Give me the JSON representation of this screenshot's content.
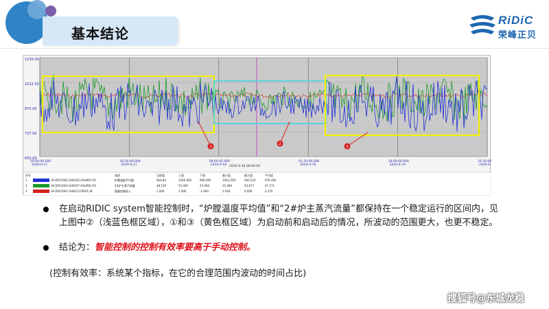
{
  "header": {
    "title": "基本结论"
  },
  "logo": {
    "name": "RiDiC",
    "subtitle": "荣峰正贝"
  },
  "chart": {
    "y_ticks": [
      "1150.00",
      "1012.50",
      "875.00",
      "737.50",
      "600.00"
    ],
    "x_ticks": [
      {
        "time": "00:00:00.000",
        "date": "2020-9-17"
      },
      {
        "time": "16:30:00.000",
        "date": "2020-9-17"
      },
      {
        "time": "09:00:00.000",
        "date": "2020-9-18"
      },
      {
        "time": "01:30:00.000",
        "date": "2020-9-19"
      },
      {
        "time": "18:00:00.000",
        "date": "2020-9-19"
      },
      {
        "time": "10:30:00.000",
        "date": "2020-9-20"
      }
    ],
    "range_label": "2020-9-18 08:00:00",
    "markers": [
      "1",
      "2",
      "3"
    ],
    "table": {
      "headers": [
        "序号",
        "",
        "",
        "描述",
        "当前值",
        "上限",
        "下限",
        "最小值",
        "最大值",
        "平均值"
      ],
      "rows": [
        [
          "1",
          "VA.DPU1002.SH0305.AALM01.PV",
          "炉膛温度平均值",
          "964.84",
          "1000.000",
          "900.000",
          "1043.558",
          "900.216",
          "978.392"
        ],
        [
          "2",
          "VA.DPU1002.SH0197.AALM01.PV",
          "2#炉主蒸汽流量",
          "48.129",
          "55.000",
          "25.000",
          "25.489",
          "54.677",
          "47.171"
        ],
        [
          "3",
          "VA.DPU1001.SH0415.PID01.IN",
          "智能控制投入",
          "1.000",
          "2.000",
          "-1.000",
          "1.000",
          "0.000",
          "0.255"
        ]
      ]
    },
    "colors": {
      "blue": "#1f2fd6",
      "green": "#1e9a2a",
      "red": "#d62020",
      "yellow": "#f2f000",
      "cyan": "#3fd6e8",
      "purple": "#c050c8"
    }
  },
  "bullets": {
    "b1": "在启动RIDIC system智能控制时，“炉膛温度平均值”和“2#炉主蒸汽流量”都保持在一个稳定运行的区间内，见上图中②（浅蓝色框区域），①和③（黄色框区域）为启动前和启动后的情况，所波动的范围更大，也更不稳定。",
    "b2_prefix": "结论为：",
    "b2_emph": "智能控制的控制有效率要高于手动控制。"
  },
  "note": "(控制有效率：系统某个指标，在它的合理范围内波动的时间占比)",
  "watermark": "搜狐号@东城龙稳"
}
